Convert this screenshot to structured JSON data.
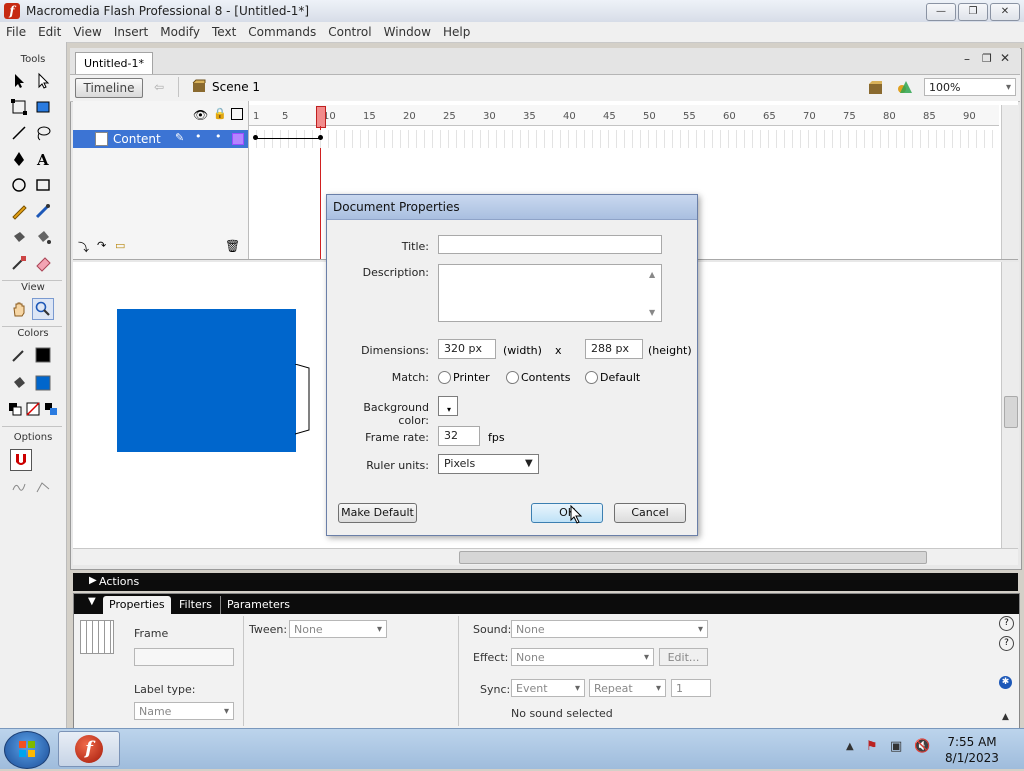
{
  "window": {
    "title": "Macromedia Flash Professional 8 - [Untitled-1*]",
    "controls": {
      "minimize": "—",
      "restore": "❐",
      "close": "✕"
    }
  },
  "menu": [
    "File",
    "Edit",
    "View",
    "Insert",
    "Modify",
    "Text",
    "Commands",
    "Control",
    "Window",
    "Help"
  ],
  "tools": {
    "header": "Tools",
    "view_header": "View",
    "colors_header": "Colors",
    "options_header": "Options"
  },
  "document": {
    "tab": "Untitled-1*",
    "timeline_button": "Timeline",
    "scene": "Scene 1",
    "zoom": "100%",
    "layer_name": "Content",
    "ruler_ticks": [
      "1",
      "5",
      "10",
      "15",
      "20",
      "25",
      "30",
      "35",
      "40",
      "45",
      "50",
      "55",
      "60",
      "65",
      "70",
      "75",
      "80",
      "85",
      "90"
    ]
  },
  "stage": {
    "rect_color": "#0066cc"
  },
  "panels": {
    "actions_label": "Actions",
    "tabs": [
      "Properties",
      "Filters",
      "Parameters"
    ],
    "frame_label": "Frame",
    "tween_label": "Tween:",
    "tween_value": "None",
    "sound_label": "Sound:",
    "sound_value": "None",
    "effect_label": "Effect:",
    "effect_value": "None",
    "edit_button": "Edit...",
    "label_type_label": "Label type:",
    "label_type_value": "Name",
    "sync_label": "Sync:",
    "sync_value": "Event",
    "repeat_value": "Repeat",
    "repeat_count": "1",
    "no_sound": "No sound selected"
  },
  "dialog": {
    "title": "Document Properties",
    "title_label": "Title:",
    "title_value": "",
    "description_label": "Description:",
    "description_value": "",
    "dimensions_label": "Dimensions:",
    "width_value": "320 px",
    "width_caption": "(width)",
    "x_label": "x",
    "height_value": "288 px",
    "height_caption": "(height)",
    "match_label": "Match:",
    "match_options": [
      "Printer",
      "Contents",
      "Default"
    ],
    "background_label": "Background color:",
    "frame_rate_label": "Frame rate:",
    "frame_rate_value": "32",
    "fps_label": "fps",
    "ruler_label": "Ruler units:",
    "ruler_value": "Pixels",
    "make_default": "Make Default",
    "ok": "OK",
    "cancel": "Cancel"
  },
  "taskbar": {
    "time": "7:55 AM",
    "date": "8/1/2023"
  }
}
